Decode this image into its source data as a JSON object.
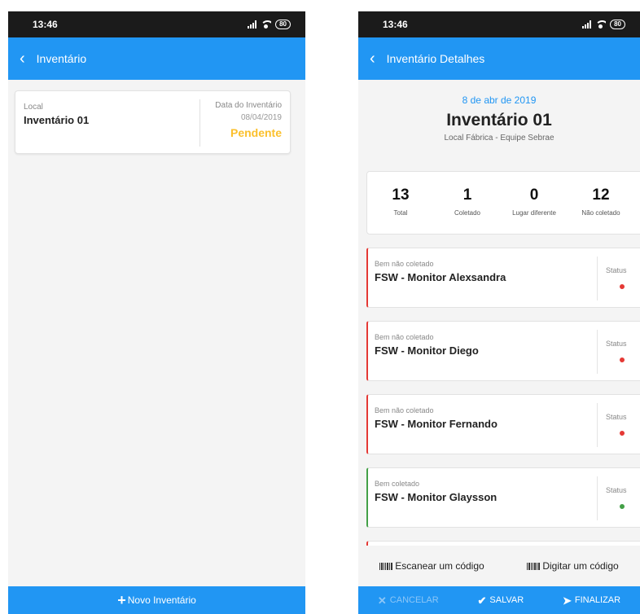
{
  "status_bar": {
    "time": "13:46",
    "battery": "80"
  },
  "left_screen": {
    "title": "Inventário",
    "card": {
      "local_label": "Local",
      "name": "Inventário 01",
      "date_label": "Data do Inventário",
      "date": "08/04/2019",
      "status": "Pendente"
    },
    "new_button": "Novo Inventário"
  },
  "right_screen": {
    "title": "Inventário Detalhes",
    "header": {
      "date": "8 de abr de 2019",
      "title": "Inventário 01",
      "subtitle": "Local Fábrica - Equipe Sebrae"
    },
    "stats": [
      {
        "value": "13",
        "label": "Total"
      },
      {
        "value": "1",
        "label": "Coletado"
      },
      {
        "value": "0",
        "label": "Lugar diferente"
      },
      {
        "value": "12",
        "label": "Não coletado"
      }
    ],
    "items": [
      {
        "label": "Bem não coletado",
        "name": "FSW - Monitor Alexsandra",
        "status_label": "Status",
        "status": "not_collected"
      },
      {
        "label": "Bem não coletado",
        "name": "FSW - Monitor Diego",
        "status_label": "Status",
        "status": "not_collected"
      },
      {
        "label": "Bem não coletado",
        "name": "FSW - Monitor Fernando",
        "status_label": "Status",
        "status": "not_collected"
      },
      {
        "label": "Bem coletado",
        "name": "FSW - Monitor Glaysson",
        "status_label": "Status",
        "status": "collected"
      }
    ],
    "scan_buttons": {
      "scan": "Escanear um código",
      "type": "Digitar um código"
    },
    "actions": {
      "cancel": "CANCELAR",
      "save": "SALVAR",
      "finish": "FINALIZAR"
    }
  },
  "colors": {
    "primary": "#2196f3",
    "pending": "#fbc02d",
    "not_collected": "#e53935",
    "collected": "#43a047"
  }
}
